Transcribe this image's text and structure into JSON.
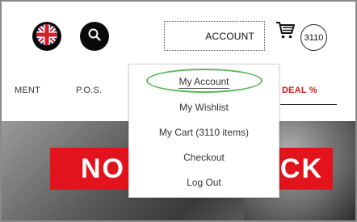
{
  "header": {
    "account_label": "ACCOUNT",
    "cart_count": "3110"
  },
  "nav": {
    "items": [
      "MENT",
      "P.O.S.",
      "DEAL %"
    ]
  },
  "banner": {
    "text_left": "NO",
    "text_right": "CK",
    "strip_color": "#e2131d"
  },
  "account_menu": {
    "items": [
      "My Account",
      "My Wishlist",
      "My Cart (3110 items)",
      "Checkout",
      "Log Out"
    ]
  },
  "colors": {
    "accent": "#d11a1a",
    "highlight": "#5cb85c"
  },
  "icons": [
    "uk-flag-icon",
    "search-icon",
    "cart-icon"
  ]
}
